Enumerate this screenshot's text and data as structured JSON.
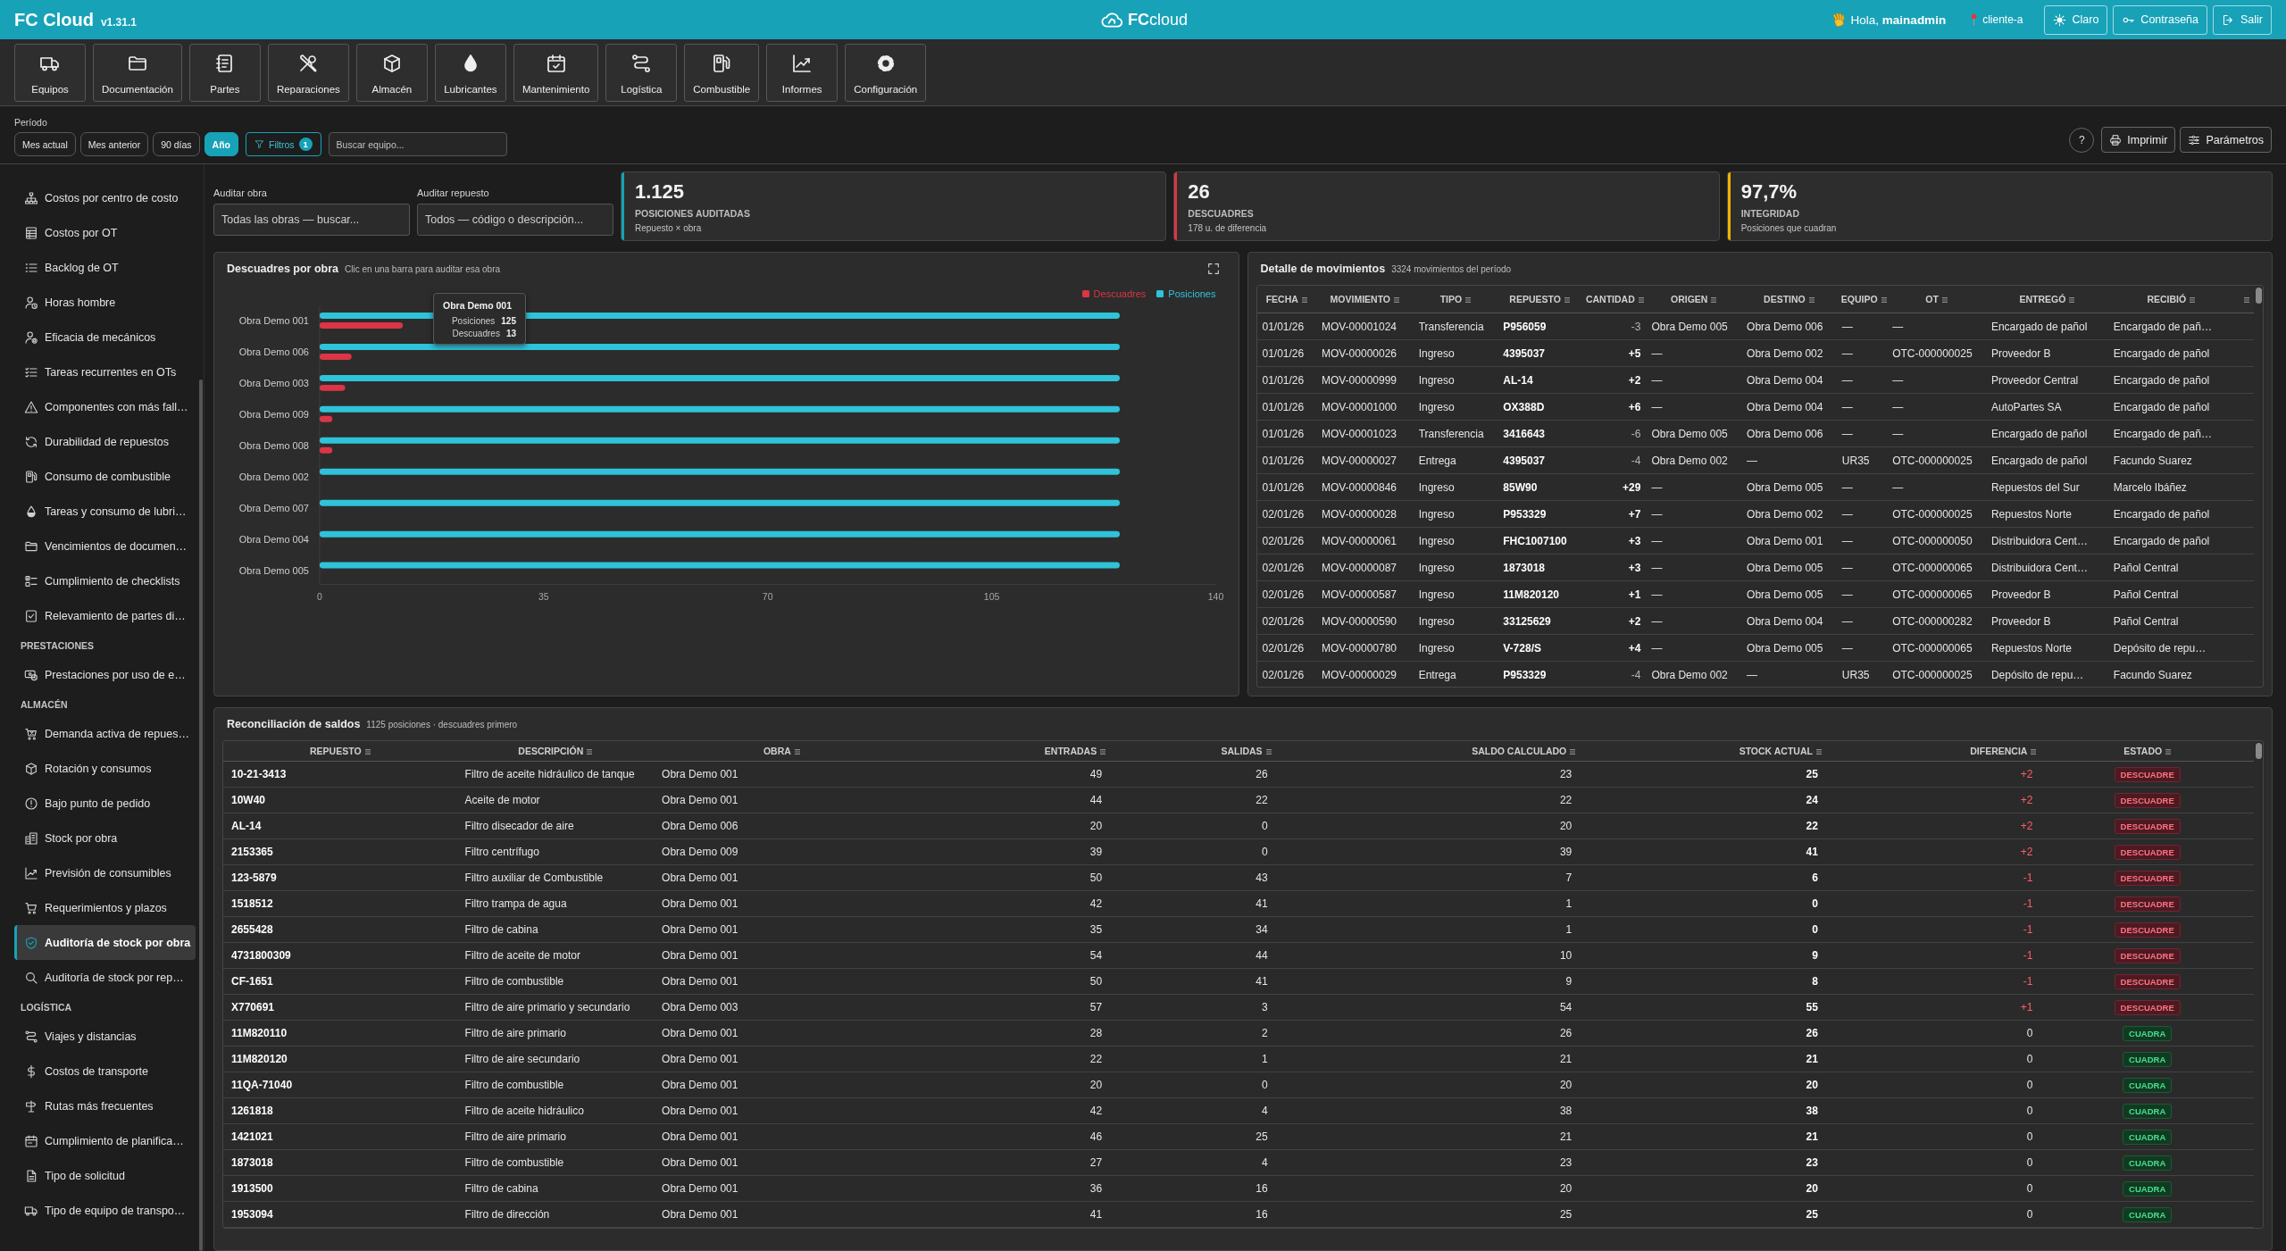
{
  "header": {
    "app_name": "FC Cloud",
    "version": "v1.31.1",
    "logo": "**FC**cloud",
    "greeting": "Hola, **mainadmin**",
    "client": "cliente-a",
    "buttons": [
      {
        "label": "Claro"
      },
      {
        "label": "Contraseña"
      },
      {
        "label": "Salir"
      }
    ]
  },
  "modules": [
    "Equipos",
    "Documentación",
    "Partes",
    "Reparaciones",
    "Almacén",
    "Lubricantes",
    "Mantenimiento",
    "Logística",
    "Combustible",
    "Informes",
    "Configuración"
  ],
  "filters": {
    "period_label": "Período",
    "periods": [
      {
        "label": "Mes actual",
        "selected": false
      },
      {
        "label": "Mes anterior",
        "selected": false
      },
      {
        "label": "90 días",
        "selected": false
      },
      {
        "label": "Año",
        "selected": true
      }
    ],
    "filter_button": {
      "label": "Filtros",
      "count": "1"
    },
    "search": {
      "placeholder": "Buscar equipo..."
    },
    "help": "?",
    "actions": [
      "Imprimir",
      "Parámetros"
    ]
  },
  "sidebar": {
    "sections": [
      {
        "items": [
          {
            "label": "Costos por centro de costo",
            "selected": false
          },
          {
            "label": "Costos por OT",
            "selected": false
          },
          {
            "label": "Backlog de OT",
            "selected": false
          },
          {
            "label": "Horas hombre",
            "selected": false
          },
          {
            "label": "Eficacia de mecánicos",
            "selected": false
          },
          {
            "label": "Tareas recurrentes en OTs",
            "selected": false
          },
          {
            "label": "Componentes con más fall…",
            "selected": false
          },
          {
            "label": "Durabilidad de repuestos",
            "selected": false
          },
          {
            "label": "Consumo de combustible",
            "selected": false
          },
          {
            "label": "Tareas y consumo de lubri…",
            "selected": false
          },
          {
            "label": "Vencimientos de documen…",
            "selected": false
          },
          {
            "label": "Cumplimiento de checklists",
            "selected": false
          },
          {
            "label": "Relevamiento de partes di…",
            "selected": false
          }
        ]
      },
      {
        "title": "PRESTACIONES",
        "items": [
          {
            "label": "Prestaciones por uso de e…",
            "selected": false
          }
        ]
      },
      {
        "title": "ALMACÉN",
        "items": [
          {
            "label": "Demanda activa de repues…",
            "selected": false
          },
          {
            "label": "Rotación y consumos",
            "selected": false
          },
          {
            "label": "Bajo punto de pedido",
            "selected": false
          },
          {
            "label": "Stock por obra",
            "selected": false
          },
          {
            "label": "Previsión de consumibles",
            "selected": false
          },
          {
            "label": "Requerimientos y plazos",
            "selected": false
          },
          {
            "label": "Auditoría de stock por obra",
            "selected": true
          },
          {
            "label": "Auditoría de stock por rep…",
            "selected": false
          }
        ]
      },
      {
        "title": "LOGÍSTICA",
        "items": [
          {
            "label": "Viajes y distancias",
            "selected": false
          },
          {
            "label": "Costos de transporte",
            "selected": false
          },
          {
            "label": "Rutas más frecuentes",
            "selected": false
          },
          {
            "label": "Cumplimiento de planifica…",
            "selected": false
          },
          {
            "label": "Tipo de solicitud",
            "selected": false
          },
          {
            "label": "Tipo de equipo de transpo…",
            "selected": false
          }
        ]
      }
    ]
  },
  "audit_fields": [
    {
      "label": "Auditar obra",
      "placeholder": "Todas las obras — buscar..."
    },
    {
      "label": "Auditar repuesto",
      "placeholder": "Todos — código o descripción..."
    }
  ],
  "kpis": [
    {
      "value": "1.125",
      "label": "POSICIONES AUDITADAS",
      "note": "Repuesto × obra",
      "color": "#17a2b8"
    },
    {
      "value": "26",
      "label": "DESCUADRES",
      "note": "178 u. de diferencia",
      "color": "#dc3545"
    },
    {
      "value": "97,7%",
      "label": "INTEGRIDAD",
      "note": "Posiciones que cuadran",
      "color": "#f0b400"
    }
  ],
  "chart_panel": {
    "title": "Descuadres por obra",
    "subtitle": "Clic en una barra para auditar esa obra",
    "chart_data": {
      "type": "bar",
      "orientation": "horizontal",
      "categories": [
        "Obra Demo 001",
        "Obra Demo 006",
        "Obra Demo 003",
        "Obra Demo 009",
        "Obra Demo 008",
        "Obra Demo 002",
        "Obra Demo 007",
        "Obra Demo 004",
        "Obra Demo 005"
      ],
      "series": [
        {
          "name": "Descuadres",
          "color": "#dc3545",
          "values": [
            13,
            5,
            4,
            2,
            2,
            0,
            0,
            0,
            0
          ]
        },
        {
          "name": "Posiciones",
          "color": "#2fc3da",
          "values": [
            125,
            125,
            125,
            125,
            125,
            125,
            125,
            125,
            125
          ]
        }
      ],
      "xlim": [
        0,
        140
      ],
      "xticks": [
        0,
        35,
        70,
        105,
        140
      ],
      "legend": "top-right"
    },
    "tooltip": {
      "title": "Obra Demo 001",
      "rows": [
        {
          "label": "Posiciones",
          "value": "125"
        },
        {
          "label": "Descuadres",
          "value": "13"
        }
      ]
    }
  },
  "movements": {
    "title": "Detalle de movimientos",
    "subtitle": "3324 movimientos del período",
    "columns": [
      "FECHA",
      "MOVIMIENTO",
      "TIPO",
      "REPUESTO",
      "CANTIDAD",
      "ORIGEN",
      "DESTINO",
      "EQUIPO",
      "OT",
      "ENTREGÓ",
      "RECIBIÓ"
    ],
    "rows": [
      {
        "fecha": "01/01/26",
        "movimiento": "MOV-00001024",
        "tipo": "Transferencia",
        "repuesto": "P956059",
        "cantidad": "-3",
        "incoming": false,
        "origen": "Obra Demo 005",
        "destino": "Obra Demo 006",
        "equipo": "—",
        "ot": "—",
        "entrego": "Encargado de pañol",
        "recibio": "Encargado de pañ…"
      },
      {
        "fecha": "01/01/26",
        "movimiento": "MOV-00000026",
        "tipo": "Ingreso",
        "repuesto": "4395037",
        "cantidad": "+5",
        "incoming": true,
        "origen": "—",
        "destino": "Obra Demo 002",
        "equipo": "—",
        "ot": "OTC-000000025",
        "entrego": "Proveedor B",
        "recibio": "Encargado de pañol"
      },
      {
        "fecha": "01/01/26",
        "movimiento": "MOV-00000999",
        "tipo": "Ingreso",
        "repuesto": "AL-14",
        "cantidad": "+2",
        "incoming": true,
        "origen": "—",
        "destino": "Obra Demo 004",
        "equipo": "—",
        "ot": "—",
        "entrego": "Proveedor Central",
        "recibio": "Encargado de pañol"
      },
      {
        "fecha": "01/01/26",
        "movimiento": "MOV-00001000",
        "tipo": "Ingreso",
        "repuesto": "OX388D",
        "cantidad": "+6",
        "incoming": true,
        "origen": "—",
        "destino": "Obra Demo 004",
        "equipo": "—",
        "ot": "—",
        "entrego": "AutoPartes SA",
        "recibio": "Encargado de pañol"
      },
      {
        "fecha": "01/01/26",
        "movimiento": "MOV-00001023",
        "tipo": "Transferencia",
        "repuesto": "3416643",
        "cantidad": "-6",
        "incoming": false,
        "origen": "Obra Demo 005",
        "destino": "Obra Demo 006",
        "equipo": "—",
        "ot": "—",
        "entrego": "Encargado de pañol",
        "recibio": "Encargado de pañ…"
      },
      {
        "fecha": "01/01/26",
        "movimiento": "MOV-00000027",
        "tipo": "Entrega",
        "repuesto": "4395037",
        "cantidad": "-4",
        "incoming": false,
        "origen": "Obra Demo 002",
        "destino": "—",
        "equipo": "UR35",
        "ot": "OTC-000000025",
        "entrego": "Encargado de pañol",
        "recibio": "Facundo Suarez"
      },
      {
        "fecha": "01/01/26",
        "movimiento": "MOV-00000846",
        "tipo": "Ingreso",
        "repuesto": "85W90",
        "cantidad": "+29",
        "incoming": true,
        "origen": "—",
        "destino": "Obra Demo 005",
        "equipo": "—",
        "ot": "—",
        "entrego": "Repuestos del Sur",
        "recibio": "Marcelo Ibáñez"
      },
      {
        "fecha": "02/01/26",
        "movimiento": "MOV-00000028",
        "tipo": "Ingreso",
        "repuesto": "P953329",
        "cantidad": "+7",
        "incoming": true,
        "origen": "—",
        "destino": "Obra Demo 002",
        "equipo": "—",
        "ot": "OTC-000000025",
        "entrego": "Repuestos Norte",
        "recibio": "Encargado de pañol"
      },
      {
        "fecha": "02/01/26",
        "movimiento": "MOV-00000061",
        "tipo": "Ingreso",
        "repuesto": "FHC1007100",
        "cantidad": "+3",
        "incoming": true,
        "origen": "—",
        "destino": "Obra Demo 001",
        "equipo": "—",
        "ot": "OTC-000000050",
        "entrego": "Distribuidora Cent…",
        "recibio": "Encargado de pañol"
      },
      {
        "fecha": "02/01/26",
        "movimiento": "MOV-00000087",
        "tipo": "Ingreso",
        "repuesto": "1873018",
        "cantidad": "+3",
        "incoming": true,
        "origen": "—",
        "destino": "Obra Demo 005",
        "equipo": "—",
        "ot": "OTC-000000065",
        "entrego": "Distribuidora Cent…",
        "recibio": "Pañol Central"
      },
      {
        "fecha": "02/01/26",
        "movimiento": "MOV-00000587",
        "tipo": "Ingreso",
        "repuesto": "11M820120",
        "cantidad": "+1",
        "incoming": true,
        "origen": "—",
        "destino": "Obra Demo 005",
        "equipo": "—",
        "ot": "OTC-000000065",
        "entrego": "Proveedor B",
        "recibio": "Pañol Central"
      },
      {
        "fecha": "02/01/26",
        "movimiento": "MOV-00000590",
        "tipo": "Ingreso",
        "repuesto": "33125629",
        "cantidad": "+2",
        "incoming": true,
        "origen": "—",
        "destino": "Obra Demo 004",
        "equipo": "—",
        "ot": "OTC-000000282",
        "entrego": "Proveedor B",
        "recibio": "Pañol Central"
      },
      {
        "fecha": "02/01/26",
        "movimiento": "MOV-00000780",
        "tipo": "Ingreso",
        "repuesto": "V-728/S",
        "cantidad": "+4",
        "incoming": true,
        "origen": "—",
        "destino": "Obra Demo 005",
        "equipo": "—",
        "ot": "OTC-000000065",
        "entrego": "Repuestos Norte",
        "recibio": "Depósito de repu…"
      },
      {
        "fecha": "02/01/26",
        "movimiento": "MOV-00000029",
        "tipo": "Entrega",
        "repuesto": "P953329",
        "cantidad": "-4",
        "incoming": false,
        "origen": "Obra Demo 002",
        "destino": "—",
        "equipo": "UR35",
        "ot": "OTC-000000025",
        "entrego": "Depósito de repu…",
        "recibio": "Facundo Suarez"
      }
    ]
  },
  "reconciliation": {
    "title": "Reconciliación de saldos",
    "subtitle": "1125 posiciones · descuadres primero",
    "columns": [
      "REPUESTO",
      "DESCRIPCIÓN",
      "OBRA",
      "ENTRADAS",
      "SALIDAS",
      "SALDO CALCULADO",
      "STOCK ACTUAL",
      "DIFERENCIA",
      "ESTADO"
    ],
    "rows": [
      {
        "repuesto": "10-21-3413",
        "descripcion": "Filtro de aceite hidráulico de tanque",
        "obra": "Obra Demo 001",
        "entradas": "49",
        "salidas": "26",
        "saldo_calculado": "23",
        "stock_actual": "25",
        "diferencia": "+2",
        "estado": "DESCUADRE",
        "balanced": false
      },
      {
        "repuesto": "10W40",
        "descripcion": "Aceite de motor",
        "obra": "Obra Demo 001",
        "entradas": "44",
        "salidas": "22",
        "saldo_calculado": "22",
        "stock_actual": "24",
        "diferencia": "+2",
        "estado": "DESCUADRE",
        "balanced": false
      },
      {
        "repuesto": "AL-14",
        "descripcion": "Filtro disecador de aire",
        "obra": "Obra Demo 006",
        "entradas": "20",
        "salidas": "0",
        "saldo_calculado": "20",
        "stock_actual": "22",
        "diferencia": "+2",
        "estado": "DESCUADRE",
        "balanced": false
      },
      {
        "repuesto": "2153365",
        "descripcion": "Filtro centrífugo",
        "obra": "Obra Demo 009",
        "entradas": "39",
        "salidas": "0",
        "saldo_calculado": "39",
        "stock_actual": "41",
        "diferencia": "+2",
        "estado": "DESCUADRE",
        "balanced": false
      },
      {
        "repuesto": "123-5879",
        "descripcion": "Filtro auxiliar de Combustible",
        "obra": "Obra Demo 001",
        "entradas": "50",
        "salidas": "43",
        "saldo_calculado": "7",
        "stock_actual": "6",
        "diferencia": "-1",
        "estado": "DESCUADRE",
        "balanced": false
      },
      {
        "repuesto": "1518512",
        "descripcion": "Filtro trampa de agua",
        "obra": "Obra Demo 001",
        "entradas": "42",
        "salidas": "41",
        "saldo_calculado": "1",
        "stock_actual": "0",
        "diferencia": "-1",
        "estado": "DESCUADRE",
        "balanced": false
      },
      {
        "repuesto": "2655428",
        "descripcion": "Filtro de cabina",
        "obra": "Obra Demo 001",
        "entradas": "35",
        "salidas": "34",
        "saldo_calculado": "1",
        "stock_actual": "0",
        "diferencia": "-1",
        "estado": "DESCUADRE",
        "balanced": false
      },
      {
        "repuesto": "4731800309",
        "descripcion": "Filtro de aceite de motor",
        "obra": "Obra Demo 001",
        "entradas": "54",
        "salidas": "44",
        "saldo_calculado": "10",
        "stock_actual": "9",
        "diferencia": "-1",
        "estado": "DESCUADRE",
        "balanced": false
      },
      {
        "repuesto": "CF-1651",
        "descripcion": "Filtro de combustible",
        "obra": "Obra Demo 001",
        "entradas": "50",
        "salidas": "41",
        "saldo_calculado": "9",
        "stock_actual": "8",
        "diferencia": "-1",
        "estado": "DESCUADRE",
        "balanced": false
      },
      {
        "repuesto": "X770691",
        "descripcion": "Filtro de aire primario y secundario",
        "obra": "Obra Demo 003",
        "entradas": "57",
        "salidas": "3",
        "saldo_calculado": "54",
        "stock_actual": "55",
        "diferencia": "+1",
        "estado": "DESCUADRE",
        "balanced": false
      },
      {
        "repuesto": "11M820110",
        "descripcion": "Filtro de aire primario",
        "obra": "Obra Demo 001",
        "entradas": "28",
        "salidas": "2",
        "saldo_calculado": "26",
        "stock_actual": "26",
        "diferencia": "0",
        "estado": "CUADRA",
        "balanced": true
      },
      {
        "repuesto": "11M820120",
        "descripcion": "Filtro de aire secundario",
        "obra": "Obra Demo 001",
        "entradas": "22",
        "salidas": "1",
        "saldo_calculado": "21",
        "stock_actual": "21",
        "diferencia": "0",
        "estado": "CUADRA",
        "balanced": true
      },
      {
        "repuesto": "11QA-71040",
        "descripcion": "Filtro de combustible",
        "obra": "Obra Demo 001",
        "entradas": "20",
        "salidas": "0",
        "saldo_calculado": "20",
        "stock_actual": "20",
        "diferencia": "0",
        "estado": "CUADRA",
        "balanced": true
      },
      {
        "repuesto": "1261818",
        "descripcion": "Filtro de aceite hidráulico",
        "obra": "Obra Demo 001",
        "entradas": "42",
        "salidas": "4",
        "saldo_calculado": "38",
        "stock_actual": "38",
        "diferencia": "0",
        "estado": "CUADRA",
        "balanced": true
      },
      {
        "repuesto": "1421021",
        "descripcion": "Filtro de aire primario",
        "obra": "Obra Demo 001",
        "entradas": "46",
        "salidas": "25",
        "saldo_calculado": "21",
        "stock_actual": "21",
        "diferencia": "0",
        "estado": "CUADRA",
        "balanced": true
      },
      {
        "repuesto": "1873018",
        "descripcion": "Filtro de combustible",
        "obra": "Obra Demo 001",
        "entradas": "27",
        "salidas": "4",
        "saldo_calculado": "23",
        "stock_actual": "23",
        "diferencia": "0",
        "estado": "CUADRA",
        "balanced": true
      },
      {
        "repuesto": "1913500",
        "descripcion": "Filtro de cabina",
        "obra": "Obra Demo 001",
        "entradas": "36",
        "salidas": "16",
        "saldo_calculado": "20",
        "stock_actual": "20",
        "diferencia": "0",
        "estado": "CUADRA",
        "balanced": true
      },
      {
        "repuesto": "1953094",
        "descripcion": "Filtro de dirección",
        "obra": "Obra Demo 001",
        "entradas": "41",
        "salidas": "16",
        "saldo_calculado": "25",
        "stock_actual": "25",
        "diferencia": "0",
        "estado": "CUADRA",
        "balanced": true
      }
    ]
  }
}
